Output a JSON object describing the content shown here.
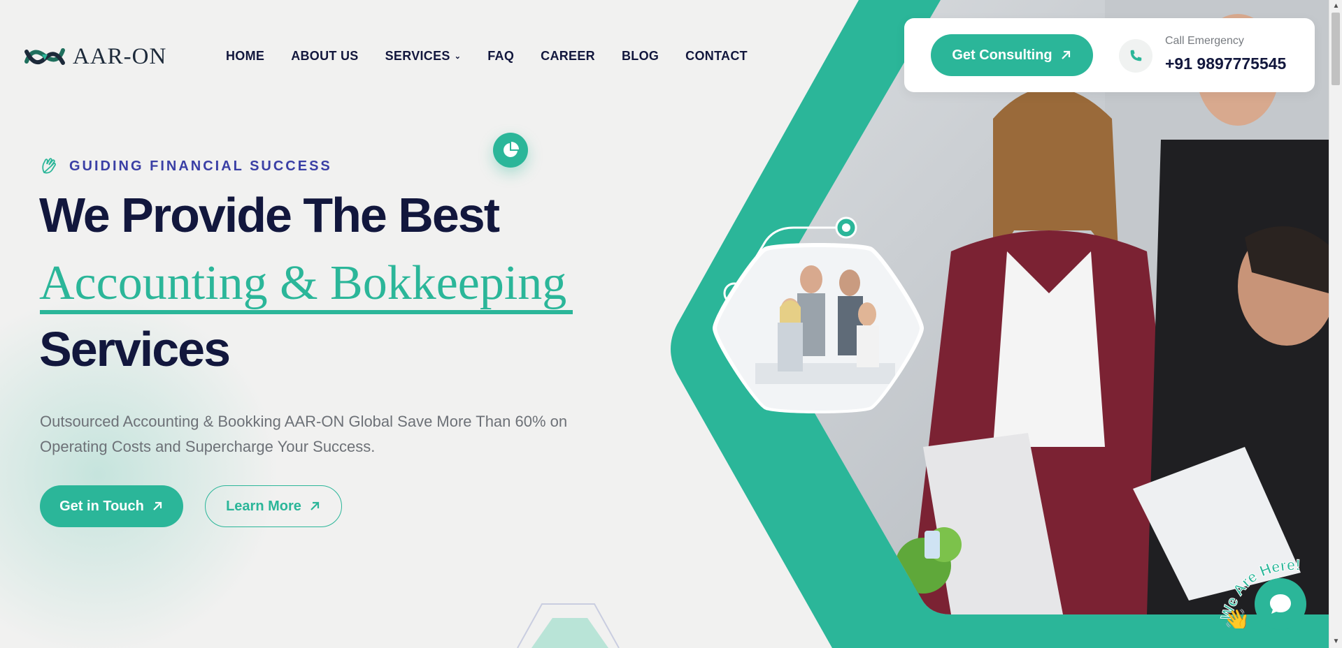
{
  "brand": {
    "name": "AAR-ON"
  },
  "nav": {
    "items": [
      {
        "label": "HOME"
      },
      {
        "label": "ABOUT US"
      },
      {
        "label": "SERVICES",
        "has_dropdown": true
      },
      {
        "label": "FAQ"
      },
      {
        "label": "CAREER"
      },
      {
        "label": "BLOG"
      },
      {
        "label": "CONTACT"
      }
    ]
  },
  "header_cta": {
    "button_label": "Get Consulting",
    "call_label": "Call Emergency",
    "phone": "+91 9897775545"
  },
  "hero": {
    "kicker": "GUIDING FINANCIAL SUCCESS",
    "line1": "We Provide The Best",
    "line2": "Accounting & Bokkeeping",
    "line3": "Services",
    "description": "Outsourced Accounting & Bookking AAR-ON Global Save More Than 60% on Operating Costs and Supercharge Your Success.",
    "primary_button": "Get in Touch",
    "secondary_button": "Learn More"
  },
  "chat": {
    "badge_text": "We Are Here!"
  },
  "colors": {
    "accent": "#2bb699",
    "navy": "#12173d",
    "kicker": "#3a3fa5",
    "background": "#f1f1f0"
  },
  "icons": [
    "logo-mark",
    "arrow-up-right-icon",
    "phone-icon",
    "hand-icon",
    "pie-chart-icon",
    "chevron-down-icon",
    "chat-icon",
    "wave-hand-icon"
  ]
}
